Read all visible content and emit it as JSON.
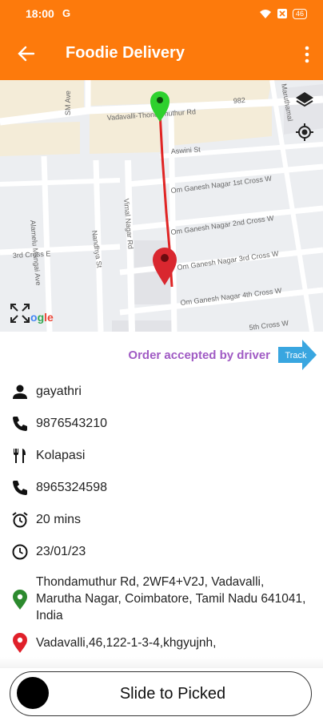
{
  "status": {
    "time": "18:00",
    "sim": "G",
    "battery": "46"
  },
  "appbar": {
    "title": "Foodie Delivery",
    "back_icon": "arrow-back-icon",
    "menu_icon": "more-vert-icon"
  },
  "map": {
    "streets": {
      "vadavalli": "Vadavalli-Thondamuthur Rd",
      "num982": "982",
      "aswini": "Aswini St",
      "og1": "Om Ganesh Nagar 1st Cross W",
      "og2": "Om Ganesh Nagar 2nd Cross W",
      "og3": "Om Ganesh Nagar 3rd Cross W",
      "og4": "Om Ganesh Nagar 4th Cross W",
      "fifth": "5th Cross W",
      "sm": "SM Ave",
      "alamelu": "Alamelu Mangai Ave",
      "vimal": "Vimal Nagar Rd",
      "nandhya": "Nandhya St",
      "third": "3rd Cross E",
      "maruthamalai": "Maruthamal",
      "google": "Google"
    },
    "colors": {
      "route": "#e02525",
      "start_pin": "#2ed12e",
      "end_pin": "#d9272f"
    }
  },
  "order": {
    "status": "Order accepted by driver",
    "track_label": "Track"
  },
  "details": {
    "customer_name": "gayathri",
    "customer_phone": "9876543210",
    "restaurant": "Kolapasi",
    "restaurant_phone": "8965324598",
    "eta": "20 mins",
    "date": "23/01/23",
    "pickup_address": "Thondamuthur Rd, 2WF4+V2J, Vadavalli, Marutha Nagar, Coimbatore, Tamil Nadu 641041, India",
    "drop_address": "Vadavalli,46,122-1-3-4,khgyujnh,"
  },
  "slider": {
    "label": "Slide to Picked"
  },
  "accent": "#fd7a0c"
}
